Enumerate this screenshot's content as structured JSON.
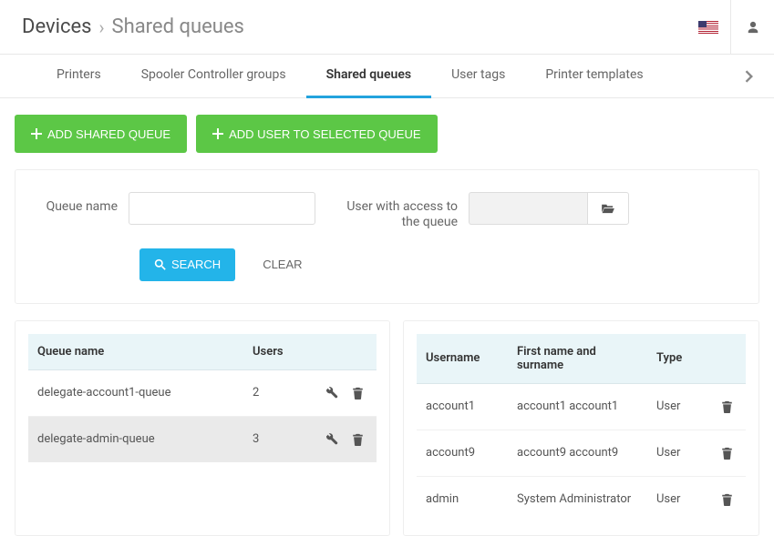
{
  "header": {
    "breadcrumb_root": "Devices",
    "breadcrumb_sub": "Shared queues"
  },
  "tabs": {
    "items": [
      {
        "label": "Printers",
        "active": false
      },
      {
        "label": "Spooler Controller groups",
        "active": false
      },
      {
        "label": "Shared queues",
        "active": true
      },
      {
        "label": "User tags",
        "active": false
      },
      {
        "label": "Printer templates",
        "active": false
      }
    ]
  },
  "actions": {
    "add_queue_label": "ADD SHARED QUEUE",
    "add_user_label": "ADD USER TO SELECTED QUEUE"
  },
  "filters": {
    "queue_name_label": "Queue name",
    "queue_name_value": "",
    "user_access_label": "User with access to the queue",
    "user_access_value": "",
    "search_label": "SEARCH",
    "clear_label": "CLEAR"
  },
  "queues_table": {
    "columns": {
      "name": "Queue name",
      "users": "Users"
    },
    "rows": [
      {
        "name": "delegate-account1-queue",
        "users": "2",
        "selected": false
      },
      {
        "name": "delegate-admin-queue",
        "users": "3",
        "selected": true
      }
    ]
  },
  "users_table": {
    "columns": {
      "username": "Username",
      "fullname": "First name and surname",
      "type": "Type"
    },
    "rows": [
      {
        "username": "account1",
        "fullname": "account1 account1",
        "type": "User"
      },
      {
        "username": "account9",
        "fullname": "account9 account9",
        "type": "User"
      },
      {
        "username": "admin",
        "fullname": "System Administrator",
        "type": "User"
      }
    ]
  }
}
